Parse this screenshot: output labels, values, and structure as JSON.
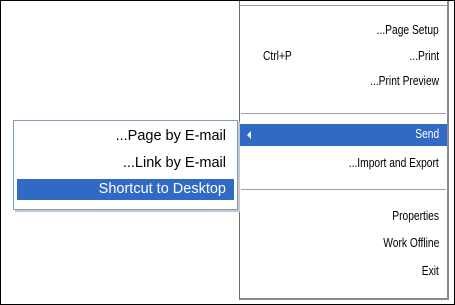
{
  "main_menu": {
    "items": [
      {
        "label": "...Page Setup",
        "shortcut": ""
      },
      {
        "label": "...Print",
        "shortcut": "Ctrl+P"
      },
      {
        "label": "...Print Preview",
        "shortcut": ""
      },
      {
        "label": "Send",
        "shortcut": "",
        "has_submenu": true,
        "selected": true
      },
      {
        "label": "...Import and Export",
        "shortcut": ""
      },
      {
        "label": "Properties",
        "shortcut": ""
      },
      {
        "label": "Work Offline",
        "shortcut": ""
      },
      {
        "label": "Exit",
        "shortcut": ""
      }
    ]
  },
  "send_submenu": {
    "items": [
      {
        "label": "...Page by E-mail"
      },
      {
        "label": "...Link by E-mail"
      },
      {
        "label": "Shortcut to Desktop",
        "selected": true
      }
    ]
  },
  "colors": {
    "selection": "#316ac5",
    "selection_text": "#ffffff",
    "menu_bg": "#ffffff",
    "separator": "#a0a0a0"
  }
}
